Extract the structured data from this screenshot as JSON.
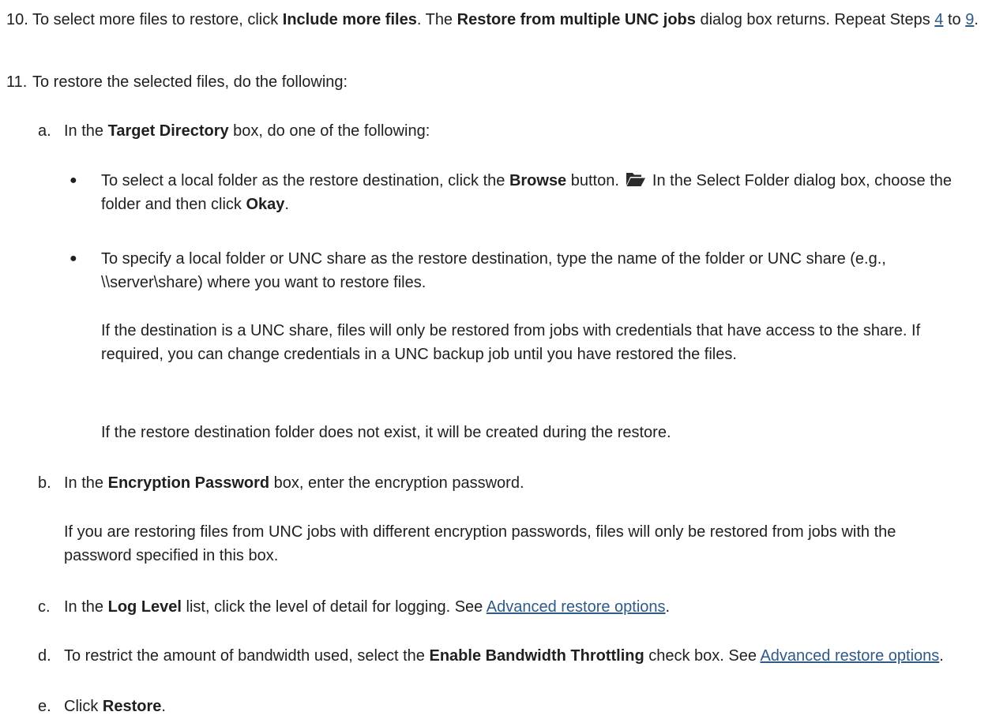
{
  "colors": {
    "text": "#1f1f1f",
    "link": "#2e5a8a"
  },
  "step10": {
    "number": "10.",
    "t1": "To select more files to restore, click ",
    "b1": "Include more files",
    "t2": ". The ",
    "b2": "Restore from multiple UNC jobs",
    "t3": " dialog box returns. Repeat Steps ",
    "link1": "4",
    "t4": " to ",
    "link2": "9",
    "t5": "."
  },
  "step11": {
    "number": "11.",
    "text": "To restore the selected files, do the following:"
  },
  "sub_a": {
    "letter": "a.",
    "t1": "In the ",
    "b1": "Target Directory",
    "t2": " box, do one of the following:",
    "bullet1": {
      "t1": "To select a local folder as the restore destination, click the ",
      "b1": "Browse",
      "t2": " button.",
      "icon": "folder-open-icon",
      "t3": "In the Select Folder dialog box, choose the folder and then click ",
      "b2": "Okay",
      "t4": "."
    },
    "bullet2": {
      "text": "To specify a local folder or UNC share as the restore destination, type the name of the folder or UNC share (e.g., \\\\server\\share) where you want to restore files.",
      "p2": "If the destination is a UNC share, files will only be restored from jobs with credentials that have access to the share. If required, you can change credentials in a UNC backup job until you have restored the files.",
      "p3": "If the restore destination folder does not exist, it will be created during the restore."
    }
  },
  "sub_b": {
    "letter": "b.",
    "t1": "In the ",
    "b1": "Encryption Password",
    "t2": " box, enter the encryption password.",
    "p2": "If you are restoring files from UNC jobs with different encryption passwords, files will only be restored from jobs with the password specified in this box."
  },
  "sub_c": {
    "letter": "c.",
    "t1": "In the ",
    "b1": "Log Level",
    "t2": " list, click the level of detail for logging. See ",
    "link": "Advanced restore options",
    "t3": "."
  },
  "sub_d": {
    "letter": "d.",
    "t1": "To restrict the amount of bandwidth used, select the ",
    "b1": "Enable Bandwidth Throttling",
    "t2": " check box. See ",
    "link": "Advanced restore options",
    "t3": "."
  },
  "sub_e": {
    "letter": "e.",
    "t1": "Click ",
    "b1": "Restore",
    "t2": "."
  }
}
